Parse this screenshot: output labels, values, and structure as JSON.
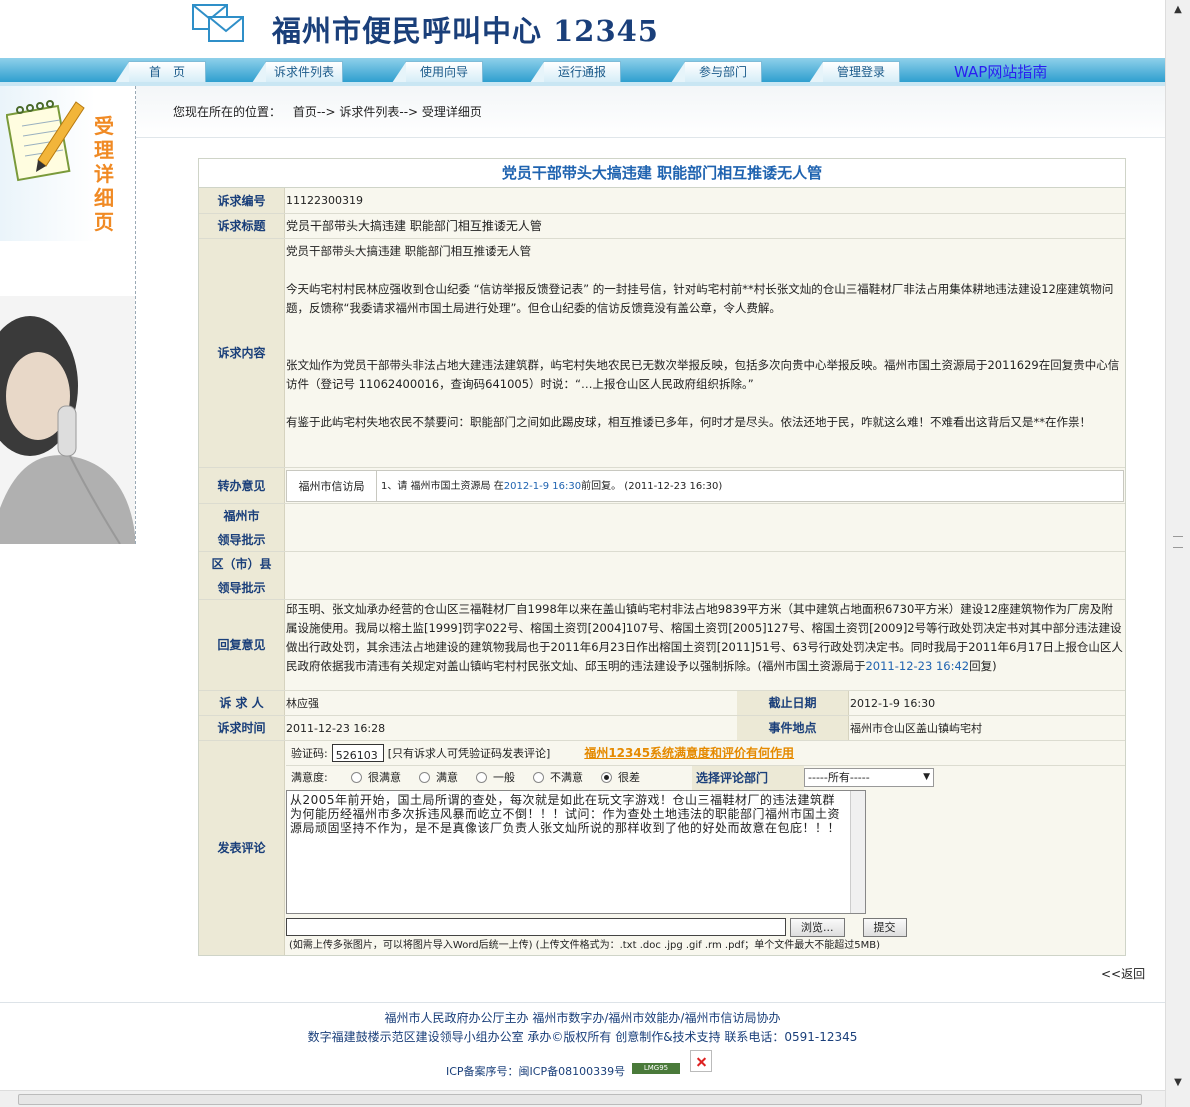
{
  "header": {
    "site_title": "福州市便民呼叫中心 12345"
  },
  "nav": {
    "tabs": [
      "首　页",
      "诉求件列表",
      "使用向导",
      "运行通报",
      "参与部门",
      "管理登录"
    ],
    "wap_link": "WAP网站指南"
  },
  "sidebar": {
    "title_chars": [
      "受",
      "理",
      "详",
      "细",
      "页"
    ]
  },
  "breadcrumb": {
    "prefix": "您现在所在的位置：",
    "path": "首页--> 诉求件列表--> 受理详细页"
  },
  "detail": {
    "title": "党员干部带头大搞违建  职能部门相互推诿无人管",
    "labels": {
      "number": "诉求编号",
      "subject": "诉求标题",
      "content": "诉求内容",
      "transfer": "转办意见",
      "city_leader_1": "福州市",
      "city_leader_2": "领导批示",
      "district_leader_1": "区（市）县",
      "district_leader_2": "领导批示",
      "reply": "回复意见",
      "petitioner": "诉 求 人",
      "deadline": "截止日期",
      "time": "诉求时间",
      "location": "事件地点",
      "comment": "发表评论"
    },
    "number": "11122300319",
    "subject": "党员干部带头大搞违建  职能部门相互推诿无人管",
    "content": [
      "党员干部带头大搞违建  职能部门相互推诿无人管",
      "今天屿宅村村民林应强收到仓山纪委 “信访举报反馈登记表” 的一封挂号信，针对屿宅村前**村长张文灿的仓山三福鞋材厂非法占用集体耕地违法建设12座建筑物问题，反馈称“我委请求福州市国土局进行处理”。但仓山纪委的信访反馈竟没有盖公章，令人费解。",
      "张文灿作为党员干部带头非法占地大建违法建筑群，屿宅村失地农民已无数次举报反映，包括多次向贵中心举报反映。福州市国土资源局于2011629在回复贵中心信访件（登记号 11062400016，查询码641005）时说：“…上报仓山区人民政府组织拆除。”",
      "有鉴于此屿宅村失地农民不禁要问：职能部门之间如此踢皮球，相互推诿已多年，何时才是尽头。依法还地于民，咋就这么难！不难看出这背后又是**在作祟！"
    ],
    "transfer": {
      "dept": "福州市信访局",
      "text_before": "1、请 福州市国土资源局 在",
      "date": "2012-1-9 16:30",
      "text_after": " 前回复。 (2011-12-23 16:30)"
    },
    "reply": {
      "text": "邱玉明、张文灿承办经营的仓山区三福鞋材厂自1998年以来在盖山镇屿宅村非法占地9839平方米（其中建筑占地面积6730平方米）建设12座建筑物作为厂房及附属设施使用。我局以榕土监[1999]罚字022号、榕国土资罚[2004]107号、榕国土资罚[2005]127号、榕国土资罚[2009]2号等行政处罚决定书对其中部分违法建设做出行政处罚，其余违法占地建设的建筑物我局也于2011年6月23日作出榕国土资罚[2011]51号、63号行政处罚决定书。同时我局于2011年6月17日上报仓山区人民政府依据我市清违有关规定对盖山镇屿宅村村民张文灿、邱玉明的违法建设予以强制拆除。(福州市国土资源局于",
      "date": "2011-12-23 16:42",
      "suffix": "回复)"
    },
    "petitioner": "林应强",
    "deadline": "2012-1-9 16:30",
    "time": "2011-12-23 16:28",
    "location": "福州市仓山区盖山镇屿宅村"
  },
  "comment_form": {
    "captcha_label": "验证码:",
    "captcha_value": "526103",
    "captcha_note": "[只有诉求人可凭验证码发表评论]",
    "survey_link": "福州12345系统满意度和评价有何作用",
    "satisfaction_label": "满意度:",
    "options": [
      "很满意",
      "满意",
      "一般",
      "不满意",
      "很差"
    ],
    "selected": "很差",
    "dept_label": "选择评论部门",
    "dept_selected": "-----所有-----",
    "comment_text": "从2005年前开始，国土局所谓的查处，每次就是如此在玩文字游戏！仓山三福鞋材厂的违法建筑群为何能历经福州市多次拆违风暴而屹立不倒！！！试问：作为查处土地违法的职能部门福州市国土资源局顽固坚持不作为，是不是真像该厂负责人张文灿所说的那样收到了他的好处而故意在包庇！！！",
    "browse_button": "浏览...",
    "submit_button": "提交",
    "upload_note": "(如需上传多张图片，可以将图片导入Word后统一上传)  (上传文件格式为：.txt .doc .jpg .gif .rm .pdf；单个文件最大不能超过5MB)"
  },
  "back_link": "<<返回",
  "footer": {
    "line1": "福州市人民政府办公厅主办  福州市数字办/福州市效能办/福州市信访局协办",
    "line2": "数字福建鼓楼示范区建设领导小组办公室  承办©版权所有  创意制作&技术支持  联系电话：0591-12345",
    "icp": "ICP备案序号：闽ICP备08100339号",
    "badge": "LMG95"
  }
}
